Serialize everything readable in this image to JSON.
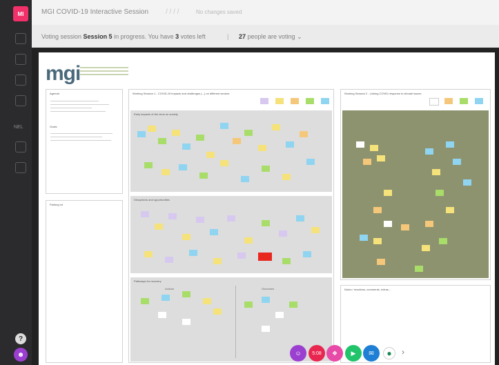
{
  "app": {
    "logo_text": "MI",
    "session_title": "MGI COVID-19 Interactive Session",
    "title_separator": "/ / / /",
    "unsaved_text": "No changes saved"
  },
  "voting": {
    "prefix": "Voting session ",
    "session": "Session 5",
    "middle": " in progress. You have ",
    "votes": "3",
    "suffix": " votes left",
    "separator": "|",
    "people_count": "27",
    "people_suffix": " people are voting"
  },
  "sidebar": {
    "icons": [
      "pen-icon",
      "shape-icon",
      "text-icon",
      "grid-icon",
      "link-icon",
      "undo-icon",
      "arrow-icon"
    ],
    "label": "NEL",
    "help": "?",
    "user": "☻"
  },
  "board": {
    "logo": "mgi",
    "panels": {
      "agenda": "Agenda",
      "goals": "Goals",
      "parking": "Parking lot",
      "ws1": "Working Session 1 - COVID-19 impacts and challenges (...) on different sectors",
      "ws2": "Working Session 2 - Linking COVID response to climate issues",
      "bottom_right": "Notes / reactions, comments, extras...",
      "zone_a": "Early impacts of the virus on society",
      "zone_b": "Disruptions and opportunities",
      "zone_c": "Pathways for recovery",
      "sub_left": "Actions",
      "sub_right": "Outcomes"
    }
  },
  "dock": {
    "items": [
      "☺",
      "5:08",
      "❖",
      "▶",
      "✉",
      "●",
      "›"
    ]
  }
}
